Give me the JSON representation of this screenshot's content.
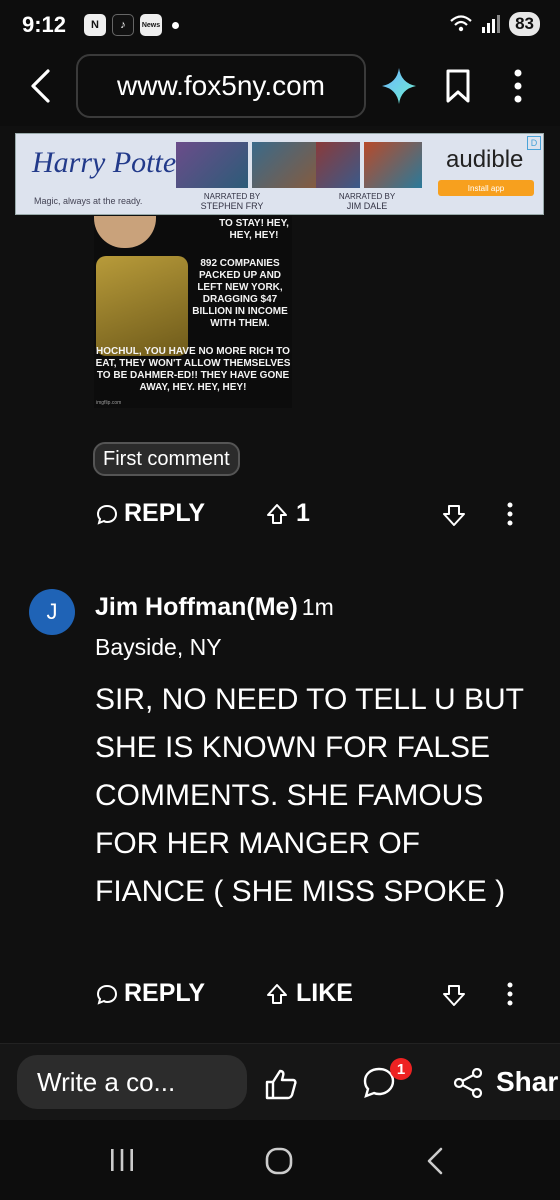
{
  "status_bar": {
    "time": "9:12",
    "battery": "83",
    "app_icons": [
      "news-app-icon",
      "tiktok-icon",
      "news-icon"
    ],
    "news_label": "News"
  },
  "browser": {
    "url": "www.fox5ny.com"
  },
  "ad": {
    "brand": "Harry Potter",
    "tagline": "Magic, always at the ready.",
    "narrator1_label": "NARRATED BY",
    "narrator1": "STEPHEN FRY",
    "narrator2_label": "NARRATED BY",
    "narrator2": "JIM DALE",
    "audible": "audible",
    "install": "Install app",
    "adchoice": "D"
  },
  "meme": {
    "line_top": "TO STAY! HEY, HEY, HEY!",
    "line_middle": "892 COMPANIES PACKED UP AND LEFT NEW YORK, DRAGGING $47 BILLION IN INCOME WITH THEM.",
    "line_bottom": "HOCHUL, YOU HAVE NO MORE RICH TO EAT, THEY WON'T ALLOW THEMSELVES TO BE DAHMER-ED!! THEY HAVE GONE AWAY, HEY. HEY, HEY!",
    "watermark": "imgflip.com"
  },
  "first_comment": {
    "label": "First comment",
    "reply": "REPLY",
    "upvotes": "1"
  },
  "comment": {
    "initial": "J",
    "author": "Jim Hoffman(Me)",
    "ago": "1m",
    "location": "Bayside, NY",
    "text": "SIR, NO NEED TO TELL U BUT SHE IS KNOWN FOR FALSE COMMENTS. SHE FAMOUS FOR HER MANGER OF FIANCE ( SHE MISS SPOKE )",
    "reply": "REPLY",
    "like": "LIKE"
  },
  "comment_bar": {
    "placeholder": "Write a co...",
    "comment_count": "1",
    "share": "Shar"
  }
}
